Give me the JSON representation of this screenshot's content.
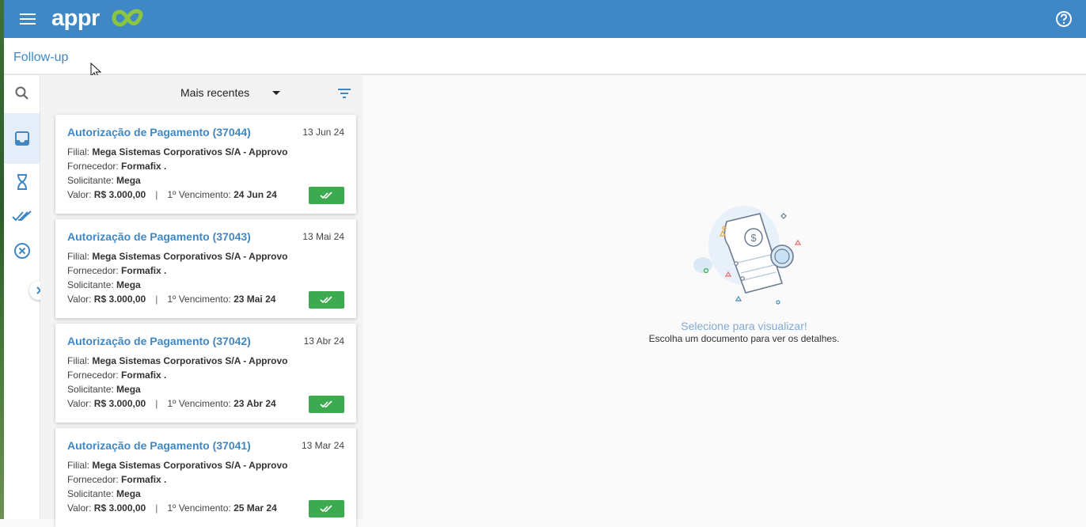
{
  "app": {
    "logo_text": "approvo",
    "colors": {
      "brand": "#3f88c5",
      "approve": "#3daa52"
    }
  },
  "header": {
    "menu_icon": "hamburger-icon",
    "help_icon": "help-circle-icon"
  },
  "subheader": {
    "title": "Follow-up"
  },
  "sidebar": {
    "items": [
      {
        "name": "search",
        "icon": "search-icon"
      },
      {
        "name": "inbox",
        "icon": "inbox-icon",
        "active": true
      },
      {
        "name": "pending",
        "icon": "hourglass-icon"
      },
      {
        "name": "approved",
        "icon": "double-check-icon"
      },
      {
        "name": "rejected",
        "icon": "cancel-circle-icon"
      }
    ],
    "expand_icon": "chevron-right-icon"
  },
  "list": {
    "sort_label": "Mais recentes",
    "labels": {
      "filial": "Filial: ",
      "fornecedor": "Fornecedor: ",
      "solicitante": "Solicitante: ",
      "valor": "Valor: ",
      "vencimento": "1º Vencimento: "
    },
    "cards": [
      {
        "title": "Autorização de Pagamento (37044)",
        "date": "13 Jun 24",
        "filial": "Mega Sistemas Corporativos S/A - Approvo",
        "fornecedor": "Formafix .",
        "solicitante": "Mega",
        "valor": "R$ 3.000,00",
        "vencimento": "24 Jun 24"
      },
      {
        "title": "Autorização de Pagamento (37043)",
        "date": "13 Mai 24",
        "filial": "Mega Sistemas Corporativos S/A - Approvo",
        "fornecedor": "Formafix .",
        "solicitante": "Mega",
        "valor": "R$ 3.000,00",
        "vencimento": "23 Mai 24"
      },
      {
        "title": "Autorização de Pagamento (37042)",
        "date": "13 Abr 24",
        "filial": "Mega Sistemas Corporativos S/A - Approvo",
        "fornecedor": "Formafix .",
        "solicitante": "Mega",
        "valor": "R$ 3.000,00",
        "vencimento": "23 Abr 24"
      },
      {
        "title": "Autorização de Pagamento (37041)",
        "date": "13 Mar 24",
        "filial": "Mega Sistemas Corporativos S/A - Approvo",
        "fornecedor": "Formafix .",
        "solicitante": "Mega",
        "valor": "R$ 3.000,00",
        "vencimento": "25 Mar 24"
      }
    ]
  },
  "detail": {
    "empty_title": "Selecione para visualizar!",
    "empty_subtitle": "Escolha um documento para ver os detalhes."
  }
}
